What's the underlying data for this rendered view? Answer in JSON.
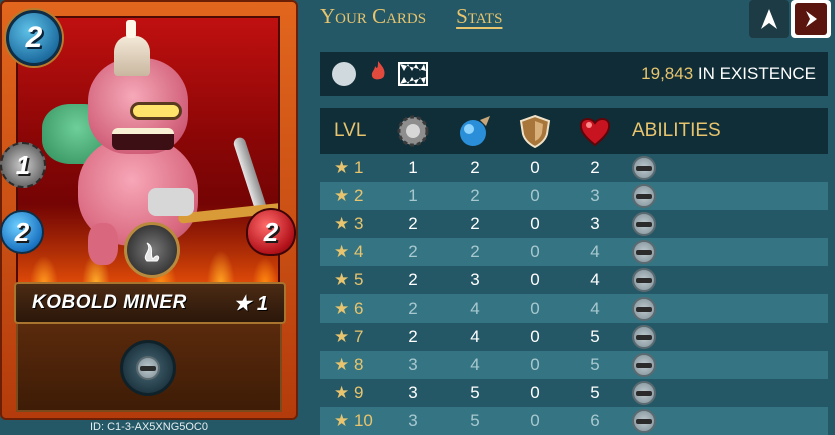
{
  "card": {
    "mana": "2",
    "attack": "1",
    "speed": "2",
    "health": "2",
    "name": "KOBOLD MINER",
    "level": "★ 1",
    "id_label": "ID: C1-3-AX5XNG5OC0",
    "element_icon": "neutral-element-icon",
    "ability_icon": "sneak-ability-icon"
  },
  "tabs": [
    {
      "label": "Your Cards",
      "active": false
    },
    {
      "label": "Stats",
      "active": true
    }
  ],
  "nav": {
    "up_icon": "arrow-up-icon",
    "next_icon": "next-chevron-icon"
  },
  "info": {
    "count": "19,843",
    "suffix": "IN EXISTENCE",
    "icons": [
      "neutral-circle-icon",
      "fire-icon",
      "monster-teeth-icon"
    ]
  },
  "table": {
    "headers": {
      "level": "LVL",
      "abilities": "ABILITIES"
    },
    "header_icons": [
      "attack-icon",
      "speed-icon",
      "armor-icon",
      "health-icon"
    ],
    "rows": [
      {
        "level": "★ 1",
        "attack": "1",
        "speed": "2",
        "armor": "0",
        "health": "2",
        "ability": "sneak-icon",
        "faded": false
      },
      {
        "level": "★ 2",
        "attack": "1",
        "speed": "2",
        "armor": "0",
        "health": "3",
        "ability": "sneak-icon",
        "faded": true
      },
      {
        "level": "★ 3",
        "attack": "2",
        "speed": "2",
        "armor": "0",
        "health": "3",
        "ability": "sneak-icon",
        "faded": false
      },
      {
        "level": "★ 4",
        "attack": "2",
        "speed": "2",
        "armor": "0",
        "health": "4",
        "ability": "sneak-icon",
        "faded": true
      },
      {
        "level": "★ 5",
        "attack": "2",
        "speed": "3",
        "armor": "0",
        "health": "4",
        "ability": "sneak-icon",
        "faded": false
      },
      {
        "level": "★ 6",
        "attack": "2",
        "speed": "4",
        "armor": "0",
        "health": "4",
        "ability": "sneak-icon",
        "faded": true
      },
      {
        "level": "★ 7",
        "attack": "2",
        "speed": "4",
        "armor": "0",
        "health": "5",
        "ability": "sneak-icon",
        "faded": false
      },
      {
        "level": "★ 8",
        "attack": "3",
        "speed": "4",
        "armor": "0",
        "health": "5",
        "ability": "sneak-icon",
        "faded": true
      },
      {
        "level": "★ 9",
        "attack": "3",
        "speed": "5",
        "armor": "0",
        "health": "5",
        "ability": "sneak-icon",
        "faded": false
      },
      {
        "level": "★ 10",
        "attack": "3",
        "speed": "5",
        "armor": "0",
        "health": "6",
        "ability": "sneak-icon",
        "faded": true
      }
    ]
  }
}
